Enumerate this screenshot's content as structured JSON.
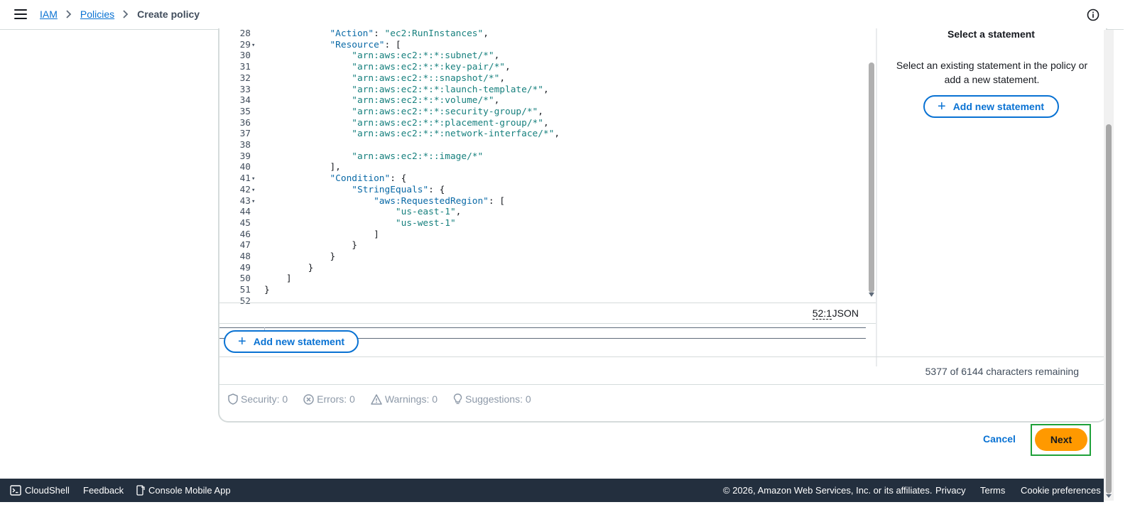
{
  "breadcrumb": {
    "iam": "IAM",
    "policies": "Policies",
    "current": "Create policy"
  },
  "editor": {
    "lines": [
      {
        "n": "28",
        "fold": "",
        "parts": [
          {
            "t": "            ",
            "c": ""
          },
          {
            "t": "\"Action\"",
            "c": "k"
          },
          {
            "t": ": ",
            "c": ""
          },
          {
            "t": "\"ec2:RunInstances\"",
            "c": "s"
          },
          {
            "t": ",",
            "c": ""
          }
        ]
      },
      {
        "n": "29",
        "fold": "▾",
        "parts": [
          {
            "t": "            ",
            "c": ""
          },
          {
            "t": "\"Resource\"",
            "c": "k"
          },
          {
            "t": ": [",
            "c": ""
          }
        ]
      },
      {
        "n": "30",
        "fold": "",
        "parts": [
          {
            "t": "                ",
            "c": ""
          },
          {
            "t": "\"arn:aws:ec2:*:*:subnet/*\"",
            "c": "s"
          },
          {
            "t": ",",
            "c": ""
          }
        ]
      },
      {
        "n": "31",
        "fold": "",
        "parts": [
          {
            "t": "                ",
            "c": ""
          },
          {
            "t": "\"arn:aws:ec2:*:*:key-pair/*\"",
            "c": "s"
          },
          {
            "t": ",",
            "c": ""
          }
        ]
      },
      {
        "n": "32",
        "fold": "",
        "parts": [
          {
            "t": "                ",
            "c": ""
          },
          {
            "t": "\"arn:aws:ec2:*::snapshot/*\"",
            "c": "s"
          },
          {
            "t": ",",
            "c": ""
          }
        ]
      },
      {
        "n": "33",
        "fold": "",
        "parts": [
          {
            "t": "                ",
            "c": ""
          },
          {
            "t": "\"arn:aws:ec2:*:*:launch-template/*\"",
            "c": "s"
          },
          {
            "t": ",",
            "c": ""
          }
        ]
      },
      {
        "n": "34",
        "fold": "",
        "parts": [
          {
            "t": "                ",
            "c": ""
          },
          {
            "t": "\"arn:aws:ec2:*:*:volume/*\"",
            "c": "s"
          },
          {
            "t": ",",
            "c": ""
          }
        ]
      },
      {
        "n": "35",
        "fold": "",
        "parts": [
          {
            "t": "                ",
            "c": ""
          },
          {
            "t": "\"arn:aws:ec2:*:*:security-group/*\"",
            "c": "s"
          },
          {
            "t": ",",
            "c": ""
          }
        ]
      },
      {
        "n": "36",
        "fold": "",
        "parts": [
          {
            "t": "                ",
            "c": ""
          },
          {
            "t": "\"arn:aws:ec2:*:*:placement-group/*\"",
            "c": "s"
          },
          {
            "t": ",",
            "c": ""
          }
        ]
      },
      {
        "n": "37",
        "fold": "",
        "parts": [
          {
            "t": "                ",
            "c": ""
          },
          {
            "t": "\"arn:aws:ec2:*:*:network-interface/*\"",
            "c": "s"
          },
          {
            "t": ",",
            "c": ""
          }
        ]
      },
      {
        "n": "38",
        "fold": "",
        "parts": []
      },
      {
        "n": "39",
        "fold": "",
        "parts": [
          {
            "t": "                ",
            "c": ""
          },
          {
            "t": "\"arn:aws:ec2:*::image/*\"",
            "c": "s"
          }
        ]
      },
      {
        "n": "40",
        "fold": "",
        "parts": [
          {
            "t": "            ],",
            "c": ""
          }
        ]
      },
      {
        "n": "41",
        "fold": "▾",
        "parts": [
          {
            "t": "            ",
            "c": ""
          },
          {
            "t": "\"Condition\"",
            "c": "k"
          },
          {
            "t": ": {",
            "c": ""
          }
        ]
      },
      {
        "n": "42",
        "fold": "▾",
        "parts": [
          {
            "t": "                ",
            "c": ""
          },
          {
            "t": "\"StringEquals\"",
            "c": "k"
          },
          {
            "t": ": {",
            "c": ""
          }
        ]
      },
      {
        "n": "43",
        "fold": "▾",
        "parts": [
          {
            "t": "                    ",
            "c": ""
          },
          {
            "t": "\"aws:RequestedRegion\"",
            "c": "k"
          },
          {
            "t": ": [",
            "c": ""
          }
        ]
      },
      {
        "n": "44",
        "fold": "",
        "parts": [
          {
            "t": "                        ",
            "c": ""
          },
          {
            "t": "\"us-east-1\"",
            "c": "s"
          },
          {
            "t": ",",
            "c": ""
          }
        ]
      },
      {
        "n": "45",
        "fold": "",
        "parts": [
          {
            "t": "                        ",
            "c": ""
          },
          {
            "t": "\"us-west-1\"",
            "c": "s"
          }
        ]
      },
      {
        "n": "46",
        "fold": "",
        "parts": [
          {
            "t": "                    ]",
            "c": ""
          }
        ]
      },
      {
        "n": "47",
        "fold": "",
        "parts": [
          {
            "t": "                }",
            "c": ""
          }
        ]
      },
      {
        "n": "48",
        "fold": "",
        "parts": [
          {
            "t": "            }",
            "c": ""
          }
        ]
      },
      {
        "n": "49",
        "fold": "",
        "parts": [
          {
            "t": "        }",
            "c": ""
          }
        ]
      },
      {
        "n": "50",
        "fold": "",
        "parts": [
          {
            "t": "    ]",
            "c": ""
          }
        ]
      },
      {
        "n": "51",
        "fold": "",
        "parts": [
          {
            "t": "}",
            "c": ""
          }
        ]
      },
      {
        "n": "52",
        "fold": "",
        "parts": []
      }
    ],
    "cursor_position": "52:1",
    "language": "JSON",
    "add_statement_label": "Add new statement"
  },
  "side_panel": {
    "title": "Select a statement",
    "description": "Select an existing statement in the policy or add a new statement.",
    "add_statement_label": "Add new statement"
  },
  "chars_remaining": "5377 of 6144 characters remaining",
  "validation": {
    "security": "Security: 0",
    "errors": "Errors: 0",
    "warnings": "Warnings: 0",
    "suggestions": "Suggestions: 0"
  },
  "actions": {
    "cancel": "Cancel",
    "next": "Next"
  },
  "footer": {
    "cloudshell": "CloudShell",
    "feedback": "Feedback",
    "mobile_app": "Console Mobile App",
    "copyright": "© 2026, Amazon Web Services, Inc. or its affiliates.",
    "privacy": "Privacy",
    "terms": "Terms",
    "cookies": "Cookie preferences"
  },
  "colors": {
    "link": "#0972d3",
    "primary": "#ff9900",
    "footer_bg": "#232f3e",
    "highlight": "#1fa13a"
  }
}
